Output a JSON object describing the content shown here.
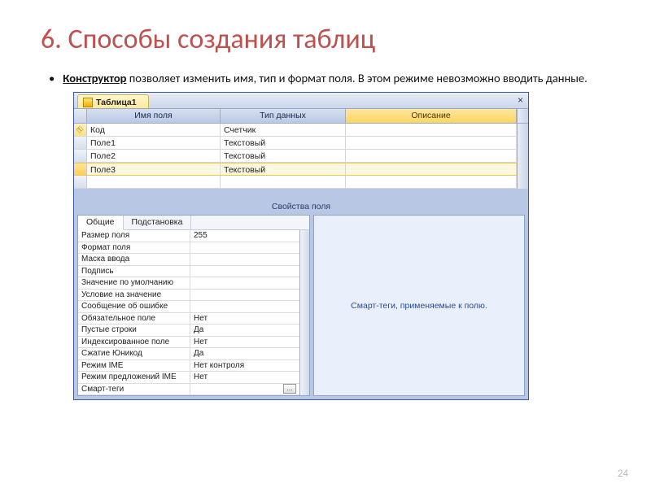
{
  "slide": {
    "title": "6. Способы создания таблиц",
    "bullet_lead": "Конструктор",
    "bullet_rest": " позволяет изменить имя, тип и формат поля. В этом режиме невозможно вводить данные.",
    "page_number": "24"
  },
  "window": {
    "tab_label": "Таблица1",
    "close_glyph": "×",
    "columns": {
      "name": "Имя поля",
      "type": "Тип данных",
      "desc": "Описание"
    },
    "rows": [
      {
        "pk": true,
        "sel": false,
        "name": "Код",
        "type": "Счетчик",
        "desc": ""
      },
      {
        "pk": false,
        "sel": false,
        "name": "Поле1",
        "type": "Текстовый",
        "desc": ""
      },
      {
        "pk": false,
        "sel": false,
        "name": "Поле2",
        "type": "Текстовый",
        "desc": ""
      },
      {
        "pk": false,
        "sel": true,
        "name": "Поле3",
        "type": "Текстовый",
        "desc": ""
      },
      {
        "pk": false,
        "sel": false,
        "name": "",
        "type": "",
        "desc": ""
      }
    ],
    "properties_caption": "Свойства поля",
    "prop_tabs": {
      "general": "Общие",
      "lookup": "Подстановка"
    },
    "properties": [
      {
        "k": "Размер поля",
        "v": "255",
        "btn": false
      },
      {
        "k": "Формат поля",
        "v": "",
        "btn": false
      },
      {
        "k": "Маска ввода",
        "v": "",
        "btn": false
      },
      {
        "k": "Подпись",
        "v": "",
        "btn": false
      },
      {
        "k": "Значение по умолчанию",
        "v": "",
        "btn": false
      },
      {
        "k": "Условие на значение",
        "v": "",
        "btn": false
      },
      {
        "k": "Сообщение об ошибке",
        "v": "",
        "btn": false
      },
      {
        "k": "Обязательное поле",
        "v": "Нет",
        "btn": false
      },
      {
        "k": "Пустые строки",
        "v": "Да",
        "btn": false
      },
      {
        "k": "Индексированное поле",
        "v": "Нет",
        "btn": false
      },
      {
        "k": "Сжатие Юникод",
        "v": "Да",
        "btn": false
      },
      {
        "k": "Режим IME",
        "v": "Нет контроля",
        "btn": false
      },
      {
        "k": "Режим предложений IME",
        "v": "Нет",
        "btn": false
      },
      {
        "k": "Смарт-теги",
        "v": "",
        "btn": true
      }
    ],
    "hint_text": "Смарт-теги, применяемые к полю.",
    "ellipsis_label": "..."
  }
}
